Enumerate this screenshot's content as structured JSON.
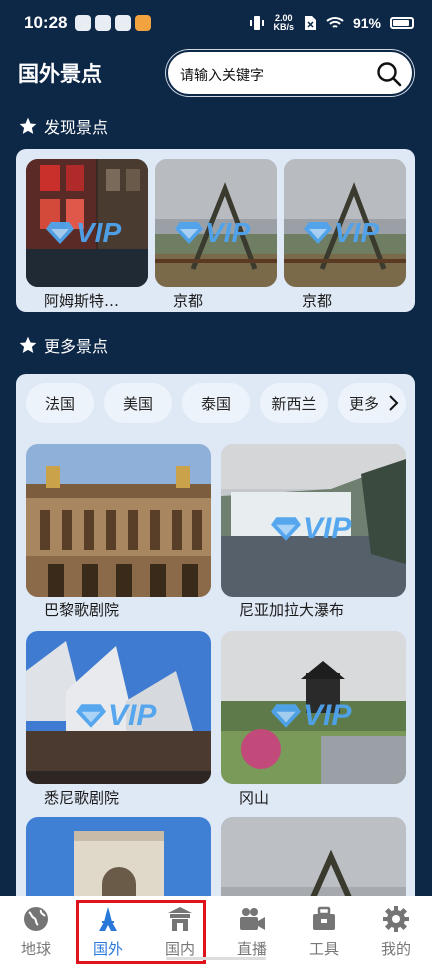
{
  "status": {
    "time": "10:28",
    "speed_top": "2.00",
    "speed_bottom": "KB/s",
    "battery": "91%"
  },
  "header": {
    "title": "国外景点",
    "search_placeholder": "请输入关键字"
  },
  "discover": {
    "title": "发现景点",
    "items": [
      {
        "label": "阿姆斯特…",
        "vip": true
      },
      {
        "label": "京都",
        "vip": true
      },
      {
        "label": "京都",
        "vip": true
      }
    ]
  },
  "more": {
    "title": "更多景点",
    "chips": [
      "法国",
      "美国",
      "泰国",
      "新西兰",
      "更多"
    ],
    "items": [
      {
        "label": "巴黎歌剧院",
        "vip": false
      },
      {
        "label": "尼亚加拉大瀑布",
        "vip": true
      },
      {
        "label": "悉尼歌剧院",
        "vip": true
      },
      {
        "label": "冈山",
        "vip": true
      },
      {
        "label": "",
        "vip": false
      },
      {
        "label": "",
        "vip": false
      }
    ]
  },
  "vip_text": "VIP",
  "tabs": [
    {
      "label": "地球",
      "icon": "globe-icon",
      "active": false
    },
    {
      "label": "国外",
      "icon": "tower-icon",
      "active": true
    },
    {
      "label": "国内",
      "icon": "pavilion-icon",
      "active": false
    },
    {
      "label": "直播",
      "icon": "camera-icon",
      "active": false
    },
    {
      "label": "工具",
      "icon": "toolbox-icon",
      "active": false
    },
    {
      "label": "我的",
      "icon": "gear-icon",
      "active": false
    }
  ],
  "colors": {
    "background": "#0d2747",
    "panel": "#dfe9f5",
    "accent": "#2878d8",
    "vip": "#4fa4ee",
    "highlight": "#e0121b"
  }
}
